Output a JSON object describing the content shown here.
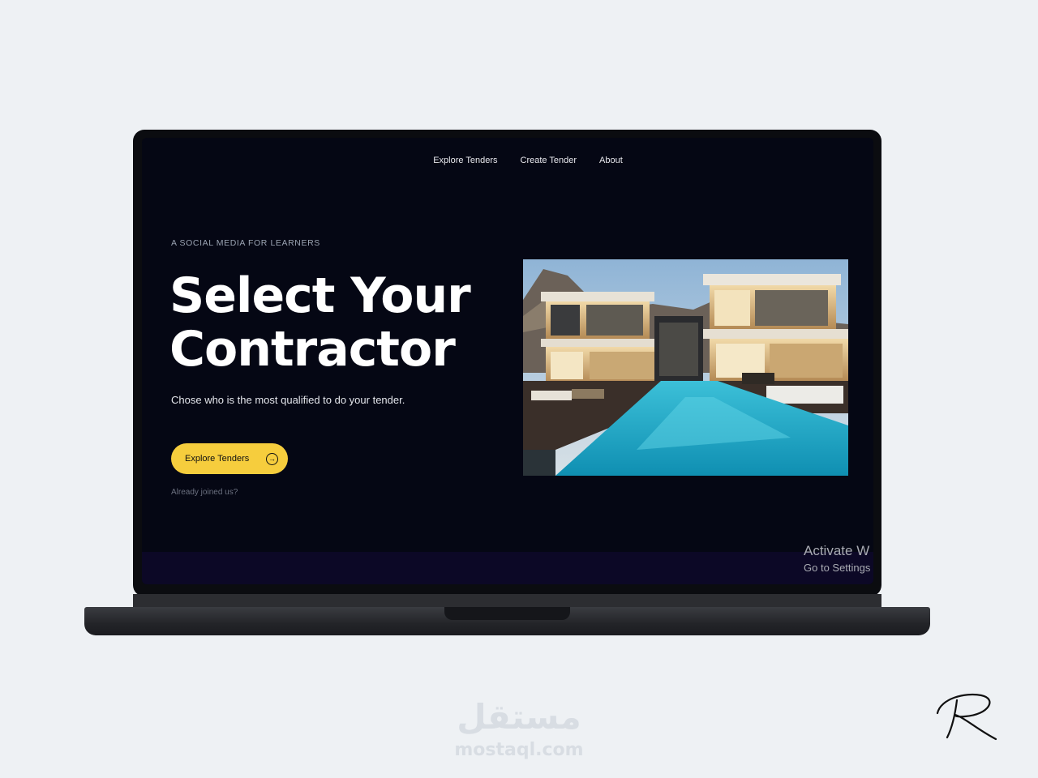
{
  "nav": {
    "items": [
      "Explore Tenders",
      "Create Tender",
      "About"
    ]
  },
  "hero": {
    "eyebrow": "A SOCIAL MEDIA FOR LEARNERS",
    "title_line1": "Select Your",
    "title_line2": "Contractor",
    "subtitle": "Chose who is the most qualified to do your tender.",
    "cta_label": "Explore Tenders",
    "cta_icon": "arrow-right-circle-icon",
    "joined_text": "Already joined us?"
  },
  "windows_notice": {
    "line1": "Activate W",
    "line2": "Go to Settings"
  },
  "watermark": {
    "arabic": "مستقل",
    "latin": "mostaql.com"
  },
  "colors": {
    "background": "#050714",
    "accent": "#f6cd3d",
    "band": "#0c0826"
  }
}
